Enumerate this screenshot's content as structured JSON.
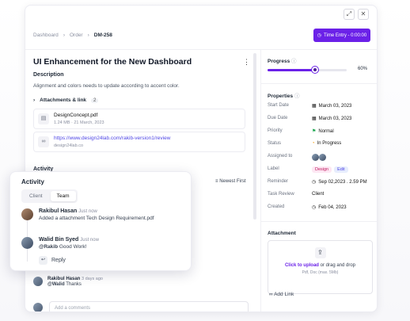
{
  "breadcrumb": [
    "Dashboard",
    "Order",
    "DM-258"
  ],
  "time_entry": "Time Entry - 0:00:00",
  "window_controls": [
    "expand-icon",
    "close-icon"
  ],
  "task": {
    "title": "UI Enhancement for the New Dashboard",
    "description_heading": "Description",
    "description": "Alignment and colors needs to update according to accent color.",
    "attachments_label": "Attachments & link",
    "attachments_count": "2",
    "files": [
      {
        "name": "DesignConcept.pdf",
        "meta": "1.24 MB · 21 March, 2023"
      },
      {
        "name": "https://www.design24lab.com/rakib-version1/review",
        "meta": "design24lab.co"
      }
    ]
  },
  "activity": {
    "heading": "Activity",
    "sort_label": "Newest First",
    "comment": {
      "name": "Rakibul Hasan",
      "time": "3 days ago",
      "mention": "@Walid",
      "text": "Thanks"
    },
    "add_placeholder": "Add a comments"
  },
  "popup": {
    "title": "Activity",
    "tabs": [
      "Client",
      "Team"
    ],
    "items": [
      {
        "name": "Rakibul Hasan",
        "time": "Just now",
        "text": "Added a attachment Tech Design Requirement.pdf"
      },
      {
        "name": "Walid Bin Syed",
        "time": "Just now",
        "mention": "@Rakib",
        "text": "Good Work!"
      }
    ],
    "reply_label": "Reply"
  },
  "progress": {
    "label": "Progress",
    "value": "60%",
    "fraction": 0.6
  },
  "properties": {
    "heading": "Properties",
    "rows": [
      {
        "key": "Start Date",
        "value": "March 03, 2023"
      },
      {
        "key": "Due Date",
        "value": "March 03, 2023"
      },
      {
        "key": "Priority",
        "value": "Normal"
      },
      {
        "key": "Status",
        "value": "In Progress"
      },
      {
        "key": "Assigned to",
        "value": ""
      },
      {
        "key": "Label",
        "value": ""
      },
      {
        "key": "Reminder",
        "value": "Sep 02,2023 . 2.59 PM"
      },
      {
        "key": "Task Review",
        "value": "Client"
      },
      {
        "key": "Created",
        "value": "Feb 04, 2023"
      }
    ],
    "labels": [
      "Design",
      "Edit"
    ]
  },
  "attachment_panel": {
    "heading": "Attachment",
    "upload_link": "Click to upload",
    "upload_rest": " or drag and drop",
    "upload_sub": "Pdf, Doc (max. 5Mb)",
    "add_link": "Add Link"
  },
  "colors": {
    "accent": "#6b21e8",
    "priority_flag": "#16a34a",
    "status_dot": "#f59e0b"
  }
}
